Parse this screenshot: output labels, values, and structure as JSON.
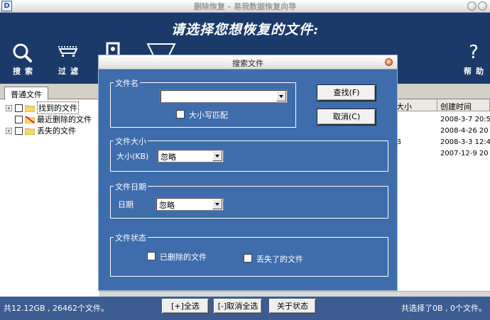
{
  "window": {
    "title": "删除恢复 - 易我数据恢复向导",
    "app_icon": "D"
  },
  "header": {
    "title": "请选择您想恢复的文件:",
    "tools": [
      {
        "label": "搜索",
        "icon": "search-icon"
      },
      {
        "label": "过滤",
        "icon": "filter-icon"
      }
    ],
    "help_label": "帮助"
  },
  "tab": {
    "label": "普通文件"
  },
  "tree": [
    {
      "label": "找到的文件",
      "icon": "folder-icon",
      "expander": "+"
    },
    {
      "label": "最近删除的文件",
      "icon": "deleted-folder-icon",
      "expander": ""
    },
    {
      "label": "丢失的文件",
      "icon": "folder-icon",
      "expander": "+"
    }
  ],
  "file_list": {
    "columns": [
      "大小",
      "创建时间"
    ],
    "rows": [
      {
        "size": "",
        "date": "2008-3-7 20:5"
      },
      {
        "size": "",
        "date": "2008-4-26 20"
      },
      {
        "size": "B",
        "date": "2008-3-3 12:4"
      },
      {
        "size": "",
        "date": "2007-12-9 20"
      }
    ]
  },
  "status": {
    "left": "共12.12GB , 26462个文件。",
    "right": "共选择了0B , 0个文件。",
    "buttons": {
      "select_all": "[+]全选",
      "deselect_all": "[-]取消全选",
      "about": "关于状态"
    }
  },
  "dialog": {
    "title": "搜索文件",
    "filename": {
      "legend": "文件名",
      "value": "",
      "case_label": "大小写匹配",
      "case_checked": false
    },
    "filesize": {
      "legend": "文件大小",
      "label": "大小(KB)",
      "value": "忽略"
    },
    "filedate": {
      "legend": "文件日期",
      "label": "日期",
      "value": "忽略"
    },
    "filestatus": {
      "legend": "文件状态",
      "deleted_label": "已删除的文件",
      "deleted_checked": false,
      "lost_label": "丢失了的文件",
      "lost_checked": false
    },
    "find_label": "查找(F)",
    "cancel_label": "取消(C)"
  },
  "colors": {
    "header_bg": "#1b3a69",
    "dialog_bg": "#3f6dac",
    "status_bg": "#3d5c92"
  }
}
